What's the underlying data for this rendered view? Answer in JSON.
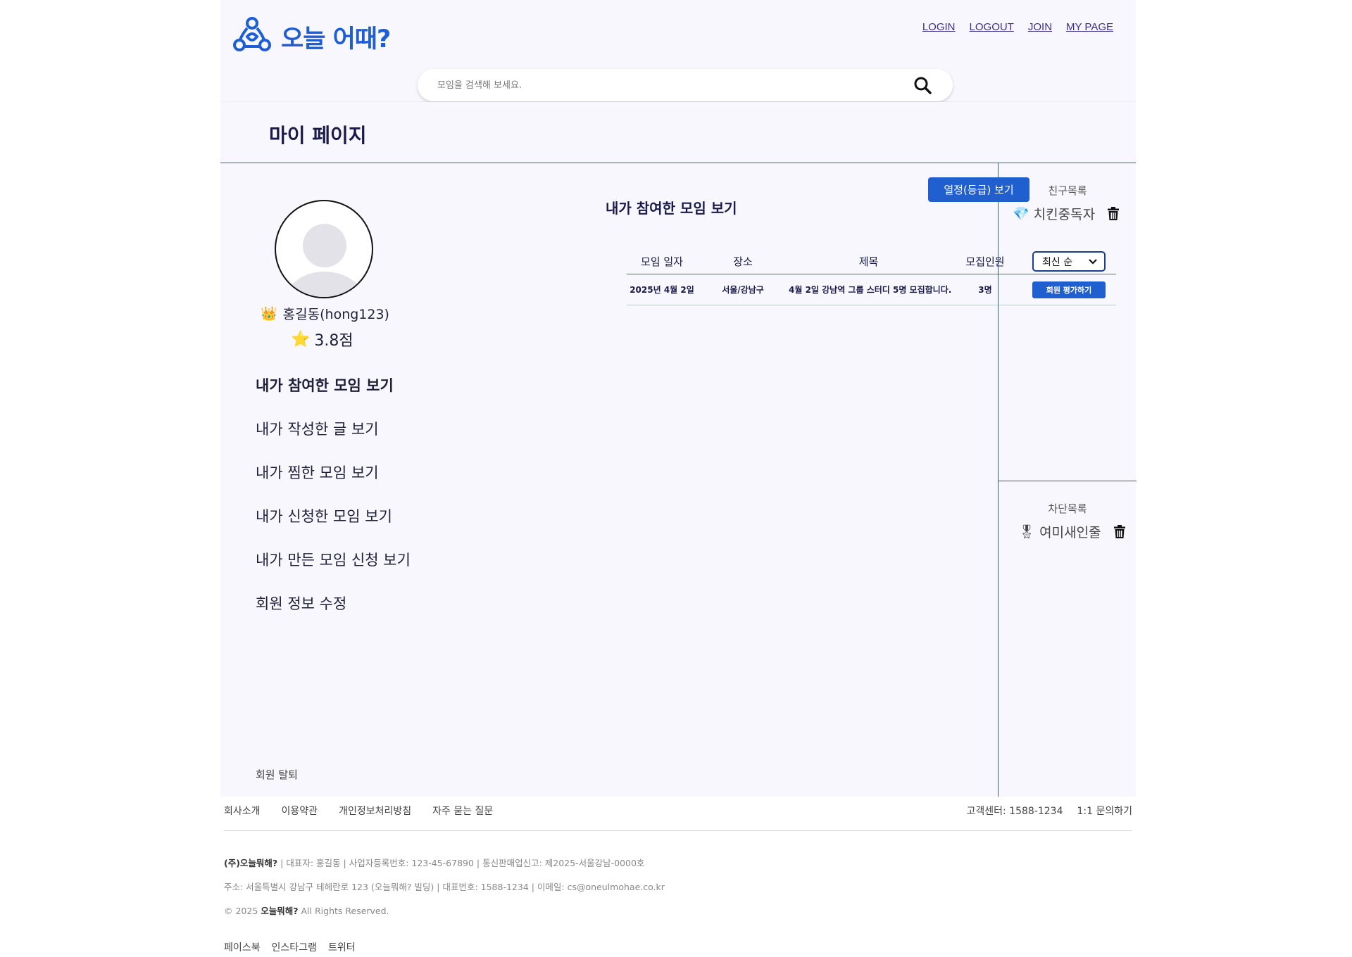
{
  "header": {
    "logo_text": "오늘 어때?",
    "nav": [
      "LOGIN",
      "LOGOUT",
      "JOIN",
      "MY PAGE"
    ],
    "search_placeholder": "모임을 검색해 보세요.",
    "icons": {
      "logo": "community-logo-icon",
      "search": "search-icon"
    },
    "colors": {
      "brand": "#1d5ed6",
      "nav_link": "#3d2e8c",
      "background": "#f7f7fd"
    }
  },
  "page_title": "마이 페이지",
  "profile": {
    "crown_icon": "👑",
    "name": "홍길동(hong123)",
    "star_icon": "⭐",
    "score": "3.8점"
  },
  "menu": [
    {
      "label": "내가 참여한 모임 보기",
      "active": true
    },
    {
      "label": "내가 작성한 글 보기",
      "active": false
    },
    {
      "label": "내가 찜한 모임 보기",
      "active": false
    },
    {
      "label": "내가 신청한 모임 보기",
      "active": false
    },
    {
      "label": "내가 만든 모임 신청 보기",
      "active": false
    },
    {
      "label": "회원 정보 수정",
      "active": false
    }
  ],
  "withdraw_label": "회원 탈퇴",
  "main": {
    "grade_button": "열정(등급) 보기",
    "section_title": "내가 참여한 모임 보기",
    "sort": {
      "selected": "최신 순"
    },
    "columns": [
      "모임 일자",
      "장소",
      "제목",
      "모집인원"
    ],
    "rows": [
      {
        "date": "2025년 4월 2일",
        "place": "서울/강남구",
        "title": "4월 2일 강남역 그룹 스터디 5명 모집합니다.",
        "count": "3명",
        "action": "회원 평가하기"
      }
    ],
    "colors": {
      "primary_button": "#1f5fd0"
    }
  },
  "sidebar": {
    "friends": {
      "title": "친구목록",
      "items": [
        {
          "icon": "💎",
          "name": "치킨중독자"
        }
      ]
    },
    "blocked": {
      "title": "차단목록",
      "items": [
        {
          "icon": "🎖",
          "name": "여미새인줄"
        }
      ]
    },
    "delete_icon": "trash-icon"
  },
  "footer": {
    "links": [
      "회사소개",
      "이용약관",
      "개인정보처리방침",
      "자주 묻는 질문"
    ],
    "right_links": [
      "고객센터: 1588-1234",
      "1:1 문의하기"
    ],
    "company": "(주)오늘뭐해?",
    "info1": " | 대표자: 홍길동 | 사업자등록번호: 123-45-67890 | 통신판매업신고: 제2025-서울강남-0000호",
    "info2": "주소: 서울특별시 강남구 테헤란로 123 (오늘뭐해? 빌딩) | 대표번호: 1588-1234 | 이메일: cs@oneulmohae.co.kr",
    "copyright_prefix": "© 2025 ",
    "copyright_brand": "오늘뭐해?",
    "copyright_suffix": " All Rights Reserved.",
    "social": [
      "페이스북",
      "인스타그램",
      "트위터"
    ]
  }
}
